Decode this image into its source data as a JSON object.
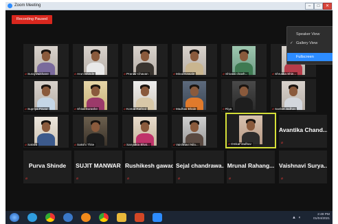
{
  "window": {
    "title": "Zoom Meeting"
  },
  "recording_badge": "Recording Paused",
  "view_menu": {
    "items": [
      {
        "label": "Speaker View",
        "checked": false,
        "icon": "speaker-view-icon"
      },
      {
        "label": "Gallery View",
        "checked": true,
        "icon": "gallery-view-icon"
      },
      {
        "label": "Fullscreen",
        "checked": false,
        "selected": true
      }
    ]
  },
  "participants_video": [
    {
      "name": "Suraj Vaikhane"
    },
    {
      "name": "Arun Shinde"
    },
    {
      "name": "Pranav Chavan"
    },
    {
      "name": "Minal Kewale"
    },
    {
      "name": "Shivani chavh..."
    },
    {
      "name": "Shrutika Shin..."
    },
    {
      "name": "Supriya Pawar"
    },
    {
      "name": "Shital Surashe"
    },
    {
      "name": "Komal Rathod"
    },
    {
      "name": "Madhav Bhale"
    },
    {
      "name": "Riya"
    },
    {
      "name": "Sanket Jadhav"
    },
    {
      "name": "Sakshi"
    },
    {
      "name": "Sakshi Thite"
    },
    {
      "name": "Sanyukta Bhat..."
    },
    {
      "name": "Vaishnavi Nila..."
    },
    {
      "name": "Omkar Jadhav"
    }
  ],
  "participants_name_only": [
    {
      "name": "Avantika Chand..."
    },
    {
      "name": "Purva Shinde"
    },
    {
      "name": "SUJIT MANWAR"
    },
    {
      "name": "Rushikesh gawad"
    },
    {
      "name": "Sejal chandrawa..."
    },
    {
      "name": "Mrunal Rahang..."
    },
    {
      "name": "Vaishnavi Surya..."
    }
  ],
  "taskbar": {
    "apps": [
      "start-button",
      "edge-icon",
      "chrome-icon",
      "ie-icon",
      "media-player-icon",
      "chrome-icon",
      "file-explorer-icon",
      "powerpoint-icon",
      "zoom-icon"
    ],
    "time": "2:49 PM",
    "date": "01/04/2021"
  },
  "colors": {
    "record_red": "#d9271e",
    "menu_highlight": "#2d8cff",
    "active_speaker": "#d6e038",
    "muted_mic": "#e53935"
  }
}
